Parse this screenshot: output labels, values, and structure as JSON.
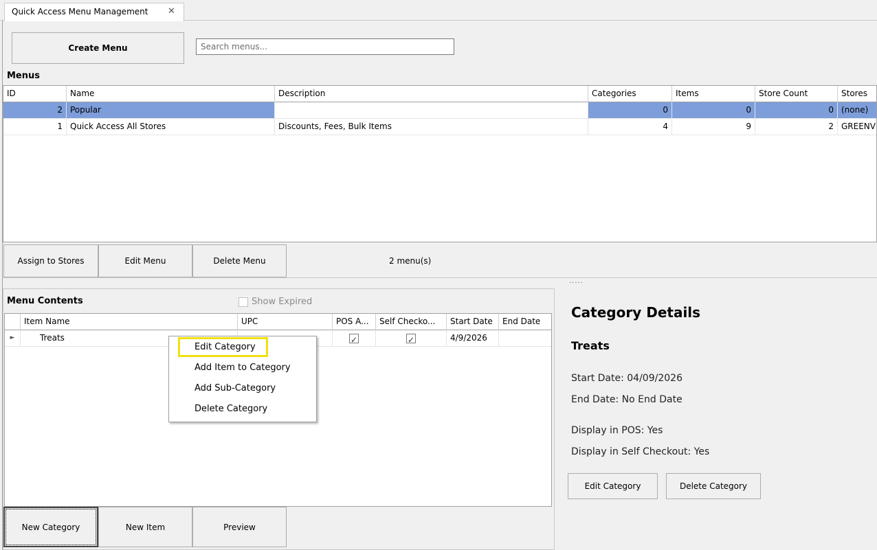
{
  "tab": {
    "title": "Quick Access Menu Management",
    "close": "✕"
  },
  "toolbar": {
    "create_label": "Create Menu",
    "search_placeholder": "Search menus..."
  },
  "menus": {
    "heading": "Menus",
    "columns": [
      "ID",
      "Name",
      "Description",
      "Categories",
      "Items",
      "Store Count",
      "Stores"
    ],
    "rows": [
      {
        "id": "2",
        "name": "Popular",
        "description": "",
        "categories": "0",
        "items": "0",
        "store_count": "0",
        "stores": "(none)"
      },
      {
        "id": "1",
        "name": "Quick Access All Stores",
        "description": "Discounts, Fees, Bulk Items",
        "categories": "4",
        "items": "9",
        "store_count": "2",
        "stores": "GREENV"
      }
    ],
    "buttons": {
      "assign": "Assign to Stores",
      "edit": "Edit Menu",
      "delete": "Delete Menu"
    },
    "count": "2 menu(s)"
  },
  "splitter": ".....",
  "contents": {
    "heading": "Menu Contents",
    "show_expired": "Show Expired",
    "columns": [
      "Item Name",
      "UPC",
      "POS A...",
      "Self Checko...",
      "Start Date",
      "End Date"
    ],
    "rows": [
      {
        "name": "Treats",
        "upc": "",
        "pos": true,
        "self_checkout": true,
        "start": "4/9/2026",
        "end": ""
      }
    ],
    "buttons": {
      "new_category": "New Category",
      "new_item": "New Item",
      "preview": "Preview"
    }
  },
  "context_menu": {
    "items": [
      "Edit Category",
      "Add Item to Category",
      "Add Sub-Category",
      "Delete Category"
    ]
  },
  "details": {
    "title": "Category Details",
    "name": "Treats",
    "start": "Start Date: 04/09/2026",
    "end": "End Date: No End Date",
    "pos": "Display in POS: Yes",
    "self_checkout": "Display in Self Checkout: Yes",
    "edit_button": "Edit Category",
    "delete_button": "Delete Category"
  },
  "colors": {
    "selection": "#7e9edb",
    "highlight": "#f2e010"
  }
}
